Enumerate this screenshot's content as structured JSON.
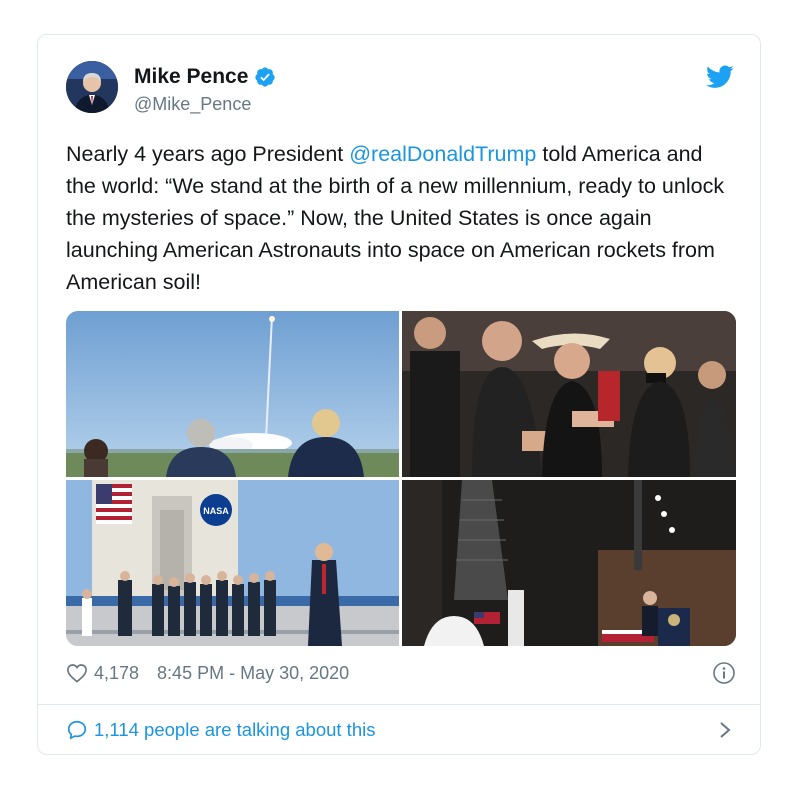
{
  "author": {
    "name": "Mike Pence",
    "handle": "@Mike_Pence",
    "verified": true
  },
  "tweet": {
    "text_before": "Nearly 4 years ago President ",
    "mention": "@realDonaldTrump",
    "text_after": " told America and the world: “We stand at the birth of a new millennium, ready to unlock the mysteries of space.” Now, the United States is once again launching American Astronauts into space on American rockets from American soil!"
  },
  "media": {
    "photos": [
      "rocket-launch-viewing-photo",
      "audience-applauding-photo",
      "nasa-building-group-photo",
      "hangar-speech-photo"
    ],
    "nasa_logo_text": "NASA"
  },
  "stats": {
    "likes": "4,178",
    "timestamp": "8:45 PM - May 30, 2020"
  },
  "footer": {
    "talking": "1,114 people are talking about this"
  },
  "colors": {
    "link": "#1b95e0",
    "secondary_text": "#657786",
    "border": "#e1e8ed",
    "verified": "#1da1f2"
  },
  "icons": [
    "twitter-bird-icon",
    "verified-badge-icon",
    "heart-icon",
    "info-icon",
    "chat-bubble-icon",
    "chevron-right-icon"
  ]
}
